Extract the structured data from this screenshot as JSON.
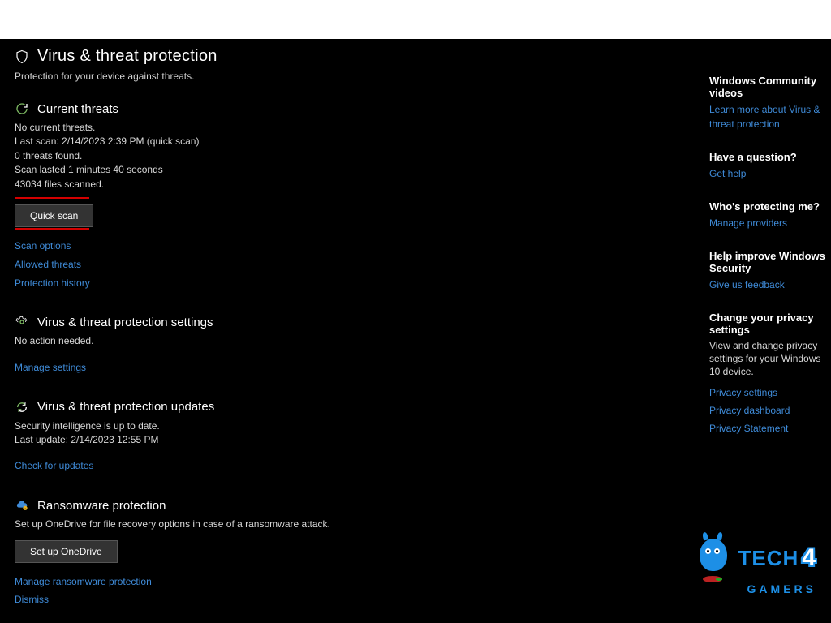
{
  "page": {
    "title": "Virus & threat protection",
    "subtitle": "Protection for your device against threats."
  },
  "current_threats": {
    "heading": "Current threats",
    "no_threats": "No current threats.",
    "last_scan": "Last scan: 2/14/2023 2:39 PM (quick scan)",
    "threats_found": "0 threats found.",
    "scan_duration": "Scan lasted 1 minutes 40 seconds",
    "files_scanned": "43034 files scanned.",
    "quick_scan_btn": "Quick scan",
    "link_scan_options": "Scan options",
    "link_allowed": "Allowed threats",
    "link_history": "Protection history"
  },
  "settings": {
    "heading": "Virus & threat protection settings",
    "status": "No action needed.",
    "link_manage": "Manage settings"
  },
  "updates": {
    "heading": "Virus & threat protection updates",
    "status": "Security intelligence is up to date.",
    "last_update": "Last update: 2/14/2023 12:55 PM",
    "link_check": "Check for updates"
  },
  "ransomware": {
    "heading": "Ransomware protection",
    "desc": "Set up OneDrive for file recovery options in case of a ransomware attack.",
    "btn_setup": "Set up OneDrive",
    "link_manage": "Manage ransomware protection",
    "link_dismiss": "Dismiss"
  },
  "sidebar": {
    "community": {
      "heading": "Windows Community videos",
      "link": "Learn more about Virus & threat protection"
    },
    "question": {
      "heading": "Have a question?",
      "link": "Get help"
    },
    "protecting": {
      "heading": "Who's protecting me?",
      "link": "Manage providers"
    },
    "improve": {
      "heading": "Help improve Windows Security",
      "link": "Give us feedback"
    },
    "privacy": {
      "heading": "Change your privacy settings",
      "desc": "View and change privacy settings for your Windows 10 device.",
      "link_settings": "Privacy settings",
      "link_dashboard": "Privacy dashboard",
      "link_statement": "Privacy Statement"
    }
  },
  "watermark": {
    "tech": "TECH",
    "four": "4",
    "gamers": "GAMERS"
  }
}
